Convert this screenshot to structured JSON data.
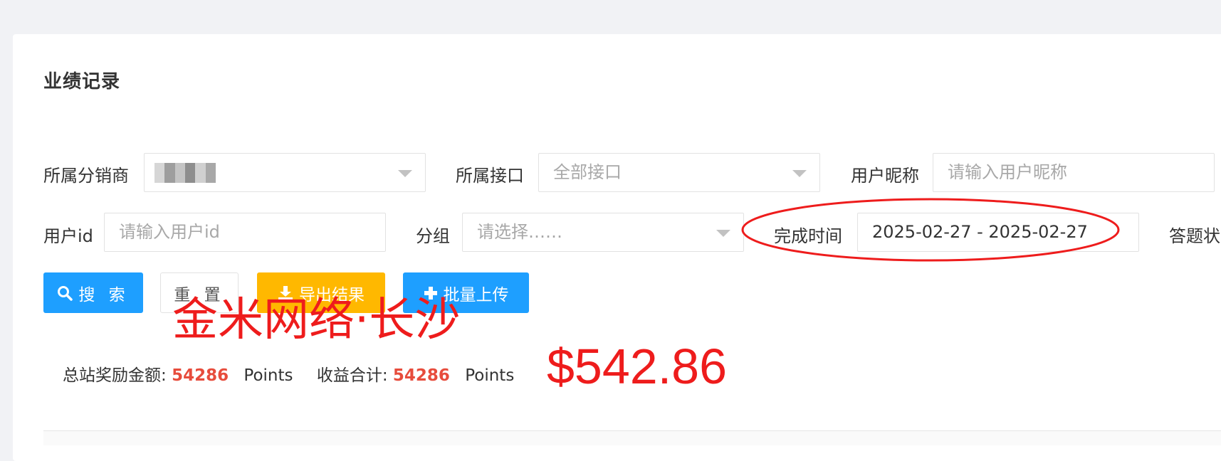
{
  "page": {
    "title": "业绩记录"
  },
  "filters": {
    "distributor": {
      "label": "所属分销商",
      "value": ""
    },
    "interface": {
      "label": "所属接口",
      "value": "全部接口"
    },
    "nickname": {
      "label": "用户昵称",
      "placeholder": "请输入用户昵称"
    },
    "user_id": {
      "label": "用户id",
      "placeholder": "请输入用户id"
    },
    "group": {
      "label": "分组",
      "value": "请选择……"
    },
    "finish_time": {
      "label": "完成时间",
      "value": "2025-02-27 - 2025-02-27"
    },
    "answer_status": {
      "label": "答题状"
    }
  },
  "buttons": {
    "search": "搜 索",
    "reset": "重 置",
    "export": "导出结果",
    "upload": "批量上传"
  },
  "stats": {
    "total_reward_label": "总站奖励金额:",
    "total_reward_value": "54286",
    "total_reward_unit": "Points",
    "income_label": "收益合计:",
    "income_value": "54286",
    "income_unit": "Points"
  },
  "annotations": {
    "watermark": "金米网络·长沙",
    "amount": "$542.86",
    "color": "#ee1c1c"
  },
  "colors": {
    "primary": "#1e9fff",
    "warning": "#ffb800",
    "highlight_number": "#e74c3c"
  },
  "icons": {
    "search": "search-icon",
    "download": "download-icon",
    "plus": "plus-icon",
    "dropdown": "caret-down-icon"
  }
}
